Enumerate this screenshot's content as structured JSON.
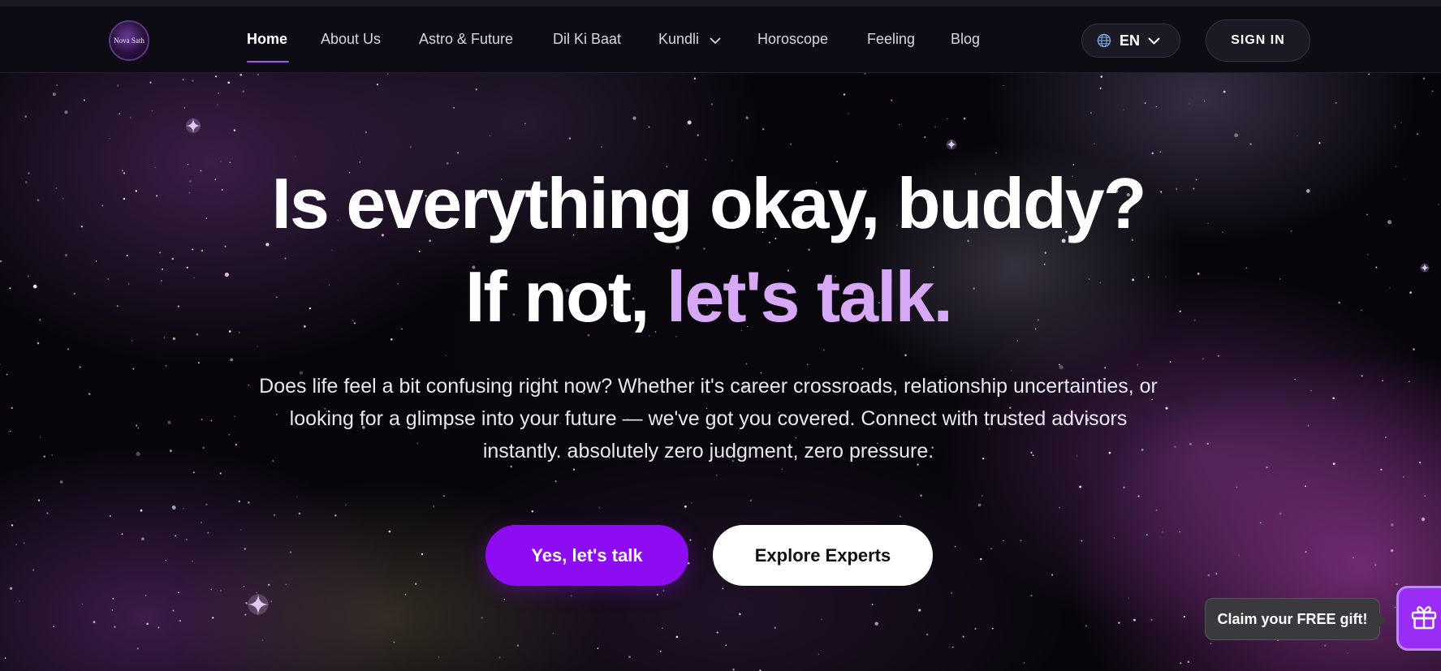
{
  "header": {
    "logo_text": "Nova Sath",
    "nav": [
      {
        "label": "Home",
        "active": true
      },
      {
        "label": "About Us",
        "active": false
      },
      {
        "label": "Astro & Future",
        "active": false
      },
      {
        "label": "Dil Ki Baat",
        "active": false
      },
      {
        "label": "Kundli",
        "active": false,
        "has_dropdown": true
      },
      {
        "label": "Horoscope",
        "active": false
      },
      {
        "label": "Feeling",
        "active": false
      },
      {
        "label": "Blog",
        "active": false
      }
    ],
    "language": {
      "selected": "EN",
      "icon": "globe-icon"
    },
    "sign_in_label": "SIGN IN"
  },
  "hero": {
    "line1": "Is everything okay, buddy?",
    "line2_plain": "If not, ",
    "line2_accent": "let's talk.",
    "description": "Does life feel a bit confusing right now? Whether it's career crossroads, relationship uncertainties, or looking for a glimpse into your future — we've got you covered. Connect with trusted advisors instantly. absolutely zero judgment, zero pressure.",
    "primary_cta": "Yes, let's talk",
    "secondary_cta": "Explore Experts"
  },
  "gift": {
    "tooltip": "Claim your FREE gift!",
    "icon": "gift-icon"
  },
  "colors": {
    "accent": "#a855f7",
    "primary_button": "#8e0cf2",
    "headline_accent": "#d6a8f5",
    "header_bg": "#0d0c14"
  }
}
